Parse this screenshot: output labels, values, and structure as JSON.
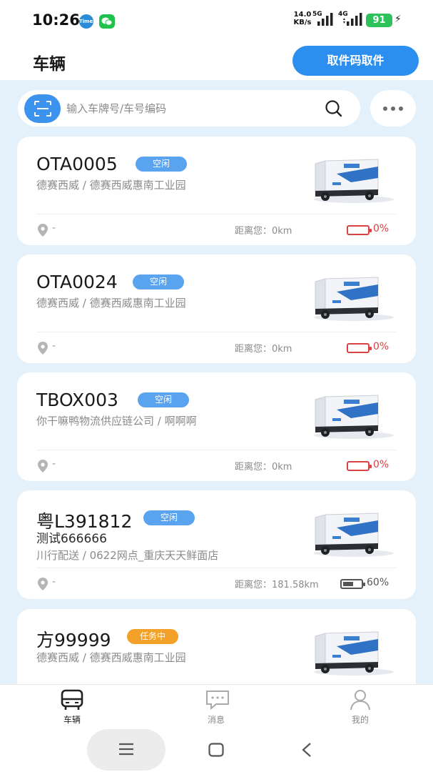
{
  "status_bar": {
    "time": "10:26",
    "app_icon": "TimeFlow",
    "speed": "14.0\nKB/s",
    "net1": "5G",
    "net2": "4G",
    "battery": "91"
  },
  "header": {
    "title": "车辆",
    "pickup_button": "取件码取件"
  },
  "search": {
    "placeholder": "输入车牌号/车号编码"
  },
  "vehicles": [
    {
      "plate": "OTA0005",
      "status": "空闲",
      "status_type": "idle",
      "name": "",
      "org": "德赛西威 / 德赛西威惠南工业园",
      "location": "-",
      "distance": "距离您：0km",
      "battery_percent": "0%",
      "battery_level": 0
    },
    {
      "plate": "OTA0024",
      "status": "空闲",
      "status_type": "idle",
      "name": "",
      "org": "德赛西威 / 德赛西威惠南工业园",
      "location": "-",
      "distance": "距离您：0km",
      "battery_percent": "0%",
      "battery_level": 0
    },
    {
      "plate": "TBOX003",
      "status": "空闲",
      "status_type": "idle",
      "name": "",
      "org": "你干嘛鸭物流供应链公司 / 啊啊啊",
      "location": "-",
      "distance": "距离您：0km",
      "battery_percent": "0%",
      "battery_level": 0
    },
    {
      "plate": "粤L391812",
      "status": "空闲",
      "status_type": "idle",
      "name": "测试666666",
      "org": "川行配送 / 0622网点_重庆天天鲜面店",
      "location": "-",
      "distance": "距离您：181.58km",
      "battery_percent": "60%",
      "battery_level": 0.6
    },
    {
      "plate": "方99999",
      "status": "任务中",
      "status_type": "busy",
      "name": "",
      "org": "德赛西威 / 德赛西威惠南工业园",
      "location": "",
      "distance": "",
      "battery_percent": "",
      "battery_level": 0
    }
  ],
  "bottom_nav": [
    {
      "label": "车辆",
      "icon": "bus-icon",
      "active": true
    },
    {
      "label": "消息",
      "icon": "message-icon",
      "active": false
    },
    {
      "label": "我的",
      "icon": "profile-icon",
      "active": false
    }
  ],
  "colors": {
    "accent": "#2c8ff0",
    "idle_badge": "#5aa3ef",
    "busy_badge": "#f3a128",
    "low_battery": "#d94343",
    "background": "#e4f0fa"
  }
}
